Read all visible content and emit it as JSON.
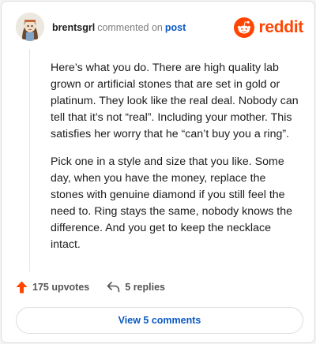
{
  "header": {
    "username": "brentsgrl",
    "verb": "commented on",
    "target": "post",
    "brand_word": "reddit"
  },
  "comment": {
    "paragraphs": [
      "Here’s what you do. There are high quality lab grown or artificial stones that are set in gold or platinum. They look like the real deal. Nobody can tell that it’s not “real”. Including your mother. This satisfies her worry that he “can’t buy you a ring”.",
      "Pick one in a style and size that you like. Some day, when you have the money, replace the stones with genuine diamond if you still feel the need to. Ring stays the same, nobody knows the difference. And you get to keep the necklace intact."
    ]
  },
  "actions": {
    "upvotes_label": "175 upvotes",
    "replies_label": "5 replies"
  },
  "view_comments_label": "View 5 comments",
  "colors": {
    "brand": "#ff4500",
    "link": "#0a58c4",
    "upvote": "#ff4500"
  },
  "icons": [
    "avatar-image",
    "reddit-logo-icon",
    "upvote-arrow-icon",
    "reply-arrow-icon"
  ]
}
